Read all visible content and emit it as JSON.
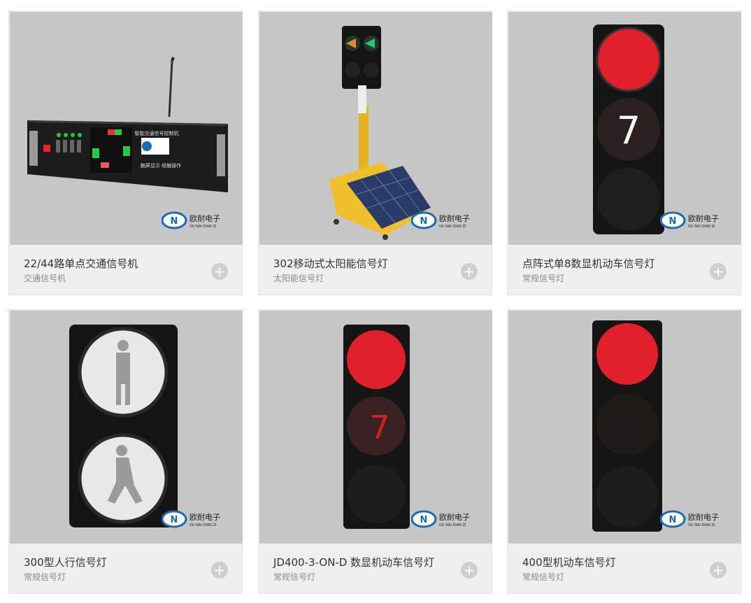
{
  "logo": {
    "brand_text": "欧耐电子",
    "brand_sub": "OU NAI DIAN ZI",
    "icon_letter": "N"
  },
  "products": [
    {
      "title": "22/44路单点交通信号机",
      "category": "交通信号机",
      "image": "signal-controller-icon",
      "device": {
        "header": "智能交通信号控制机",
        "footer": "触屏显示  轻触操作"
      }
    },
    {
      "title": "302移动式太阳能信号灯",
      "category": "太阳能信号灯",
      "image": "solar-mobile-signal-icon"
    },
    {
      "title": "点阵式单8数显机动车信号灯",
      "category": "常规信号灯",
      "image": "countdown-signal-icon",
      "device": {
        "digit": "7"
      }
    },
    {
      "title": "300型人行信号灯",
      "category": "常规信号灯",
      "image": "pedestrian-signal-icon"
    },
    {
      "title": "JD400-3-ON-D 数显机动车信号灯",
      "category": "常规信号灯",
      "image": "digital-signal-icon"
    },
    {
      "title": "400型机动车信号灯",
      "category": "常规信号灯",
      "image": "vehicle-signal-icon"
    }
  ],
  "plus_symbol": "+",
  "colors": {
    "card_bg": "#efefef",
    "photo_bg": "#c6c6c6",
    "red_lamp": "#e0202a",
    "green_lamp": "#2bd46a",
    "logo_blue": "#1a6bb5"
  }
}
